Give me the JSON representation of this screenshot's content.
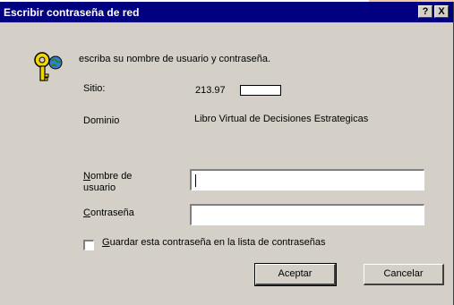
{
  "window": {
    "title": "Escribir contraseña de red",
    "help_label": "?",
    "close_label": "X"
  },
  "prompt": "escriba su nombre de usuario y contraseña.",
  "site": {
    "label": "Sitio:",
    "value": "213.97"
  },
  "domain": {
    "label": "Dominio",
    "value": "Libro Virtual de Decisiones Estrategicas"
  },
  "username": {
    "label_line1_accel": "N",
    "label_line1_rest": "ombre de",
    "label_line2": "usuario",
    "value": ""
  },
  "password": {
    "label_accel": "C",
    "label_rest": "ontraseña",
    "value": ""
  },
  "save_password": {
    "label_accel": "G",
    "label_rest": "uardar esta contraseña en la lista de contraseñas",
    "checked": false
  },
  "buttons": {
    "ok": "Aceptar",
    "cancel": "Cancelar"
  },
  "colors": {
    "titlebar": "#000080",
    "dialog": "#d4d0c8"
  }
}
